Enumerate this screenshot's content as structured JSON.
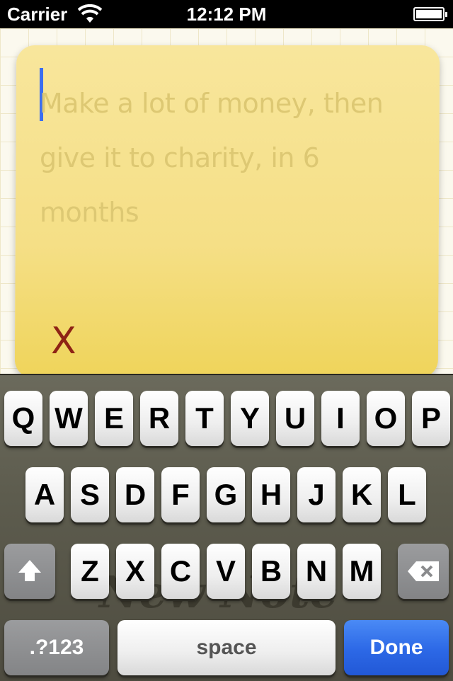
{
  "status_bar": {
    "carrier": "Carrier",
    "time": "12:12 PM",
    "wifi_icon": "wifi-icon",
    "battery_icon": "battery-icon"
  },
  "note": {
    "text_line1": "Make a lot of money, then",
    "text_line2": "give it to charity, in 6",
    "text_line3": "months",
    "delete_label": "X"
  },
  "background_text": "New Note",
  "keyboard": {
    "row1": [
      "Q",
      "W",
      "E",
      "R",
      "T",
      "Y",
      "U",
      "I",
      "O",
      "P"
    ],
    "row2": [
      "A",
      "S",
      "D",
      "F",
      "G",
      "H",
      "J",
      "K",
      "L"
    ],
    "row3": [
      "Z",
      "X",
      "C",
      "V",
      "B",
      "N",
      "M"
    ],
    "shift_icon": "shift-arrow-icon",
    "delete_icon": "backspace-icon",
    "mode_label": ".?123",
    "space_label": "space",
    "done_label": "Done"
  },
  "colors": {
    "note_yellow": "#f5df86",
    "cursor_blue": "#3c6ef0",
    "done_blue": "#2c68e6",
    "delete_red": "#8e2315"
  }
}
